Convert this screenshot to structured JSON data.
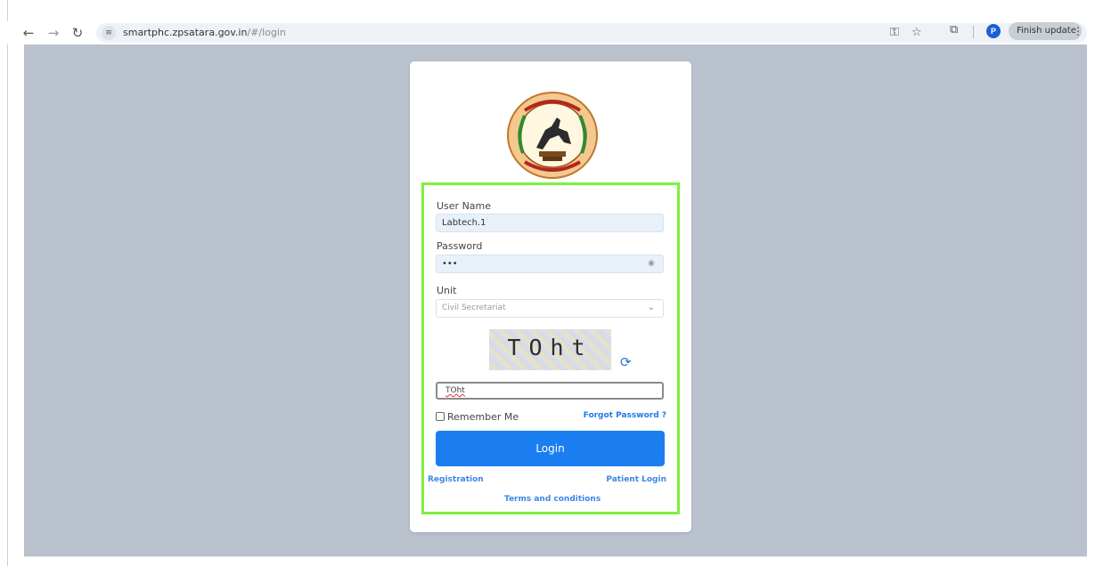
{
  "browser": {
    "url_host": "smartphc.zpsatara.gov.in",
    "url_path": "/#/login",
    "finish_update_label": "Finish update",
    "profile_initial": "P",
    "icons": [
      "back-arrow-icon",
      "forward-arrow-icon",
      "reload-icon",
      "site-settings-icon",
      "password-key-icon",
      "bookmark-star-icon",
      "extensions-icon",
      "menu-dots-icon"
    ]
  },
  "login": {
    "username_label": "User Name",
    "username_value": "Labtech.1",
    "password_label": "Password",
    "password_value": "•••",
    "unit_label": "Unit",
    "unit_selected": "Civil Secretariat",
    "captcha_text": "TOht",
    "captcha_input_value": "TOht",
    "remember_label": "Remember Me",
    "forgot_label": "Forgot Password ?",
    "login_button": "Login",
    "registration_link": "Registration",
    "patient_login_link": "Patient Login",
    "terms_link": "Terms and conditions"
  },
  "colors": {
    "page_bg": "#b9c1cd",
    "highlight_border": "#7cf23a",
    "primary_button": "#1a7ef0",
    "link": "#3d86e6"
  }
}
